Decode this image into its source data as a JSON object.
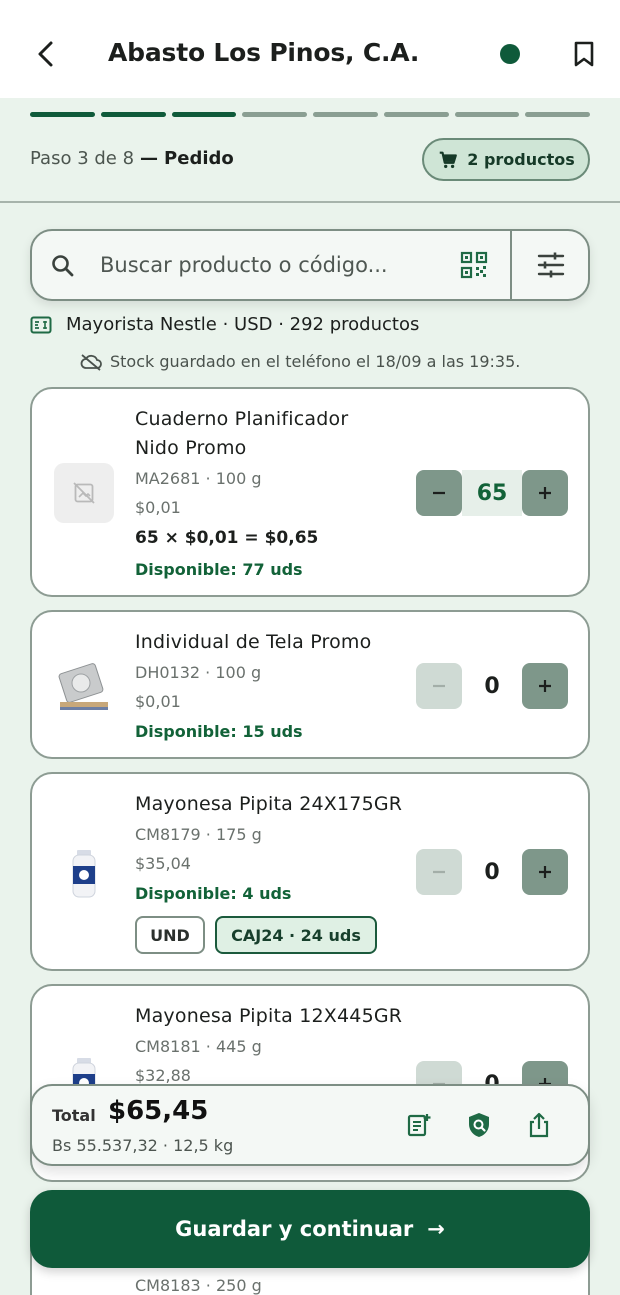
{
  "header": {
    "title": "Abasto Los Pinos, C.A.",
    "status_color": "#0f5a3a"
  },
  "progress": {
    "total_steps": 8,
    "current_step": 3,
    "step_text": "Paso 3 de 8",
    "separator": "—",
    "step_name": "Pedido"
  },
  "cart": {
    "label": "2 productos"
  },
  "search": {
    "placeholder": "Buscar producto o código..."
  },
  "catalog": {
    "info": "Mayorista Nestle · USD · 292 productos",
    "sync_note": "Stock guardado en el teléfono el 18/09 a las 19:35."
  },
  "products": [
    {
      "name_line1": "Cuaderno Planificador",
      "name_line2": "Nido Promo",
      "meta": "MA2681 · 100 g",
      "price": "$0,01",
      "line_total": "65 × $0,01 = $0,65",
      "available": "Disponible: 77 uds",
      "qty": "65",
      "image": "no-image-icon"
    },
    {
      "name_line1": "Individual de Tela Promo",
      "meta": "DH0132 · 100 g",
      "price": "$0,01",
      "available": "Disponible: 15 uds",
      "qty": "0",
      "image": "placemat-image"
    },
    {
      "name_line1": "Mayonesa Pipita 24X175GR",
      "meta": "CM8179 · 175 g",
      "price": "$35,04",
      "available": "Disponible: 4 uds",
      "qty": "0",
      "image": "mayonnaise-jar-image",
      "units": [
        "UND",
        "CAJ24 · 24 uds"
      ]
    },
    {
      "name_line1": "Mayonesa Pipita 12X445GR",
      "meta": "CM8181 · 445 g",
      "price": "$32,88",
      "qty": "0",
      "image": "mayonnaise-jar-image"
    },
    {
      "meta": "CM8183 · 250 g"
    }
  ],
  "totals": {
    "label": "Total",
    "value": "$65,45",
    "sub": "Bs 55.537,32 · 12,5 kg"
  },
  "cta": {
    "label": "Guardar y continuar",
    "arrow": "→"
  },
  "colors": {
    "primary": "#0f5a3a",
    "available_text": "#126238",
    "background": "#eaf3ec"
  }
}
